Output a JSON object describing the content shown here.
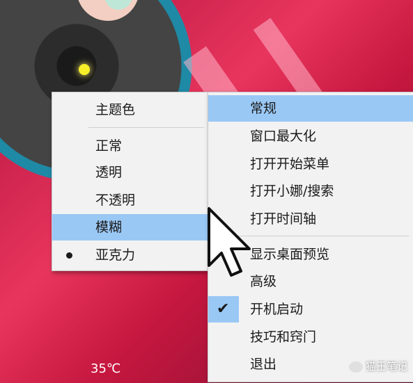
{
  "left_menu": {
    "items": [
      {
        "label": "主题色",
        "highlighted": false,
        "bullet": false
      },
      {
        "label": "正常",
        "highlighted": false,
        "bullet": false
      },
      {
        "label": "透明",
        "highlighted": false,
        "bullet": false
      },
      {
        "label": "不透明",
        "highlighted": false,
        "bullet": false
      },
      {
        "label": "模糊",
        "highlighted": true,
        "bullet": false
      },
      {
        "label": "亚克力",
        "highlighted": false,
        "bullet": true
      }
    ]
  },
  "right_menu": {
    "items": [
      {
        "label": "常规",
        "highlighted": true,
        "checked": false
      },
      {
        "label": "窗口最大化",
        "highlighted": false,
        "checked": false
      },
      {
        "label": "打开开始菜单",
        "highlighted": false,
        "checked": false
      },
      {
        "label": "打开小娜/搜索",
        "highlighted": false,
        "checked": false
      },
      {
        "label": "打开时间轴",
        "highlighted": false,
        "checked": false
      },
      {
        "label": "显示桌面预览",
        "highlighted": false,
        "checked": false
      },
      {
        "label": "高级",
        "highlighted": false,
        "checked": false
      },
      {
        "label": "开机启动",
        "highlighted": false,
        "checked": true
      },
      {
        "label": "技巧和窍门",
        "highlighted": false,
        "checked": false
      },
      {
        "label": "退出",
        "highlighted": false,
        "checked": false
      }
    ]
  },
  "taskbar": {
    "temperature": "35℃"
  },
  "watermark": {
    "text": "猫王笔记"
  },
  "colors": {
    "highlight": "#9ac8f5",
    "menu_bg": "#f2f2f2"
  }
}
